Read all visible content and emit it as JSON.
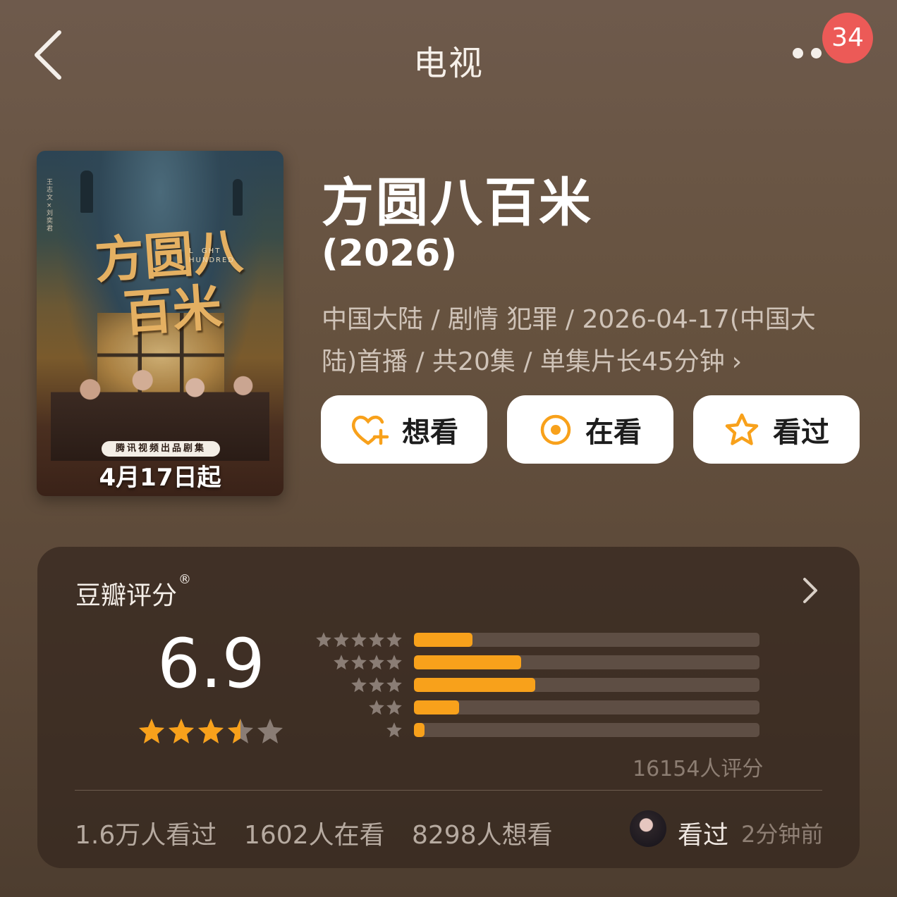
{
  "header": {
    "title": "电视",
    "notification_count": "34"
  },
  "poster": {
    "calligraphy_title": "方圆八百米",
    "english_title": "L  GHT\nHUNDRED",
    "side_credits": "王志文 ×刘奕君",
    "studio_ribbon": "腾讯视频出品剧集",
    "release_date": "4月17日起"
  },
  "show": {
    "title": "方圆八百米",
    "year": "(2026)",
    "meta": "中国大陆 / 剧情 犯罪 / 2026-04-17(中国大陆)首播 / 共20集 / 单集片长45分钟"
  },
  "actions": [
    {
      "label": "想看",
      "icon": "heart-plus-icon"
    },
    {
      "label": "在看",
      "icon": "target-icon"
    },
    {
      "label": "看过",
      "icon": "star-outline-icon"
    }
  ],
  "rating": {
    "title": "豆瓣评分",
    "registered_mark": "®",
    "score": "6.9",
    "score_stars": 3.5,
    "distribution": [
      {
        "stars": 5,
        "fraction": 0.17
      },
      {
        "stars": 4,
        "fraction": 0.31
      },
      {
        "stars": 3,
        "fraction": 0.35
      },
      {
        "stars": 2,
        "fraction": 0.13
      },
      {
        "stars": 1,
        "fraction": 0.03
      }
    ],
    "count_label": "16154人评分"
  },
  "stats": {
    "watched": "1.6万人看过",
    "watching": "1602人在看",
    "want": "8298人想看"
  },
  "activity": {
    "status": "看过",
    "time": "2分钟前"
  },
  "colors": {
    "accent": "#f8a11b",
    "badge": "#ec5a57",
    "star_empty": "#8a7d75"
  }
}
